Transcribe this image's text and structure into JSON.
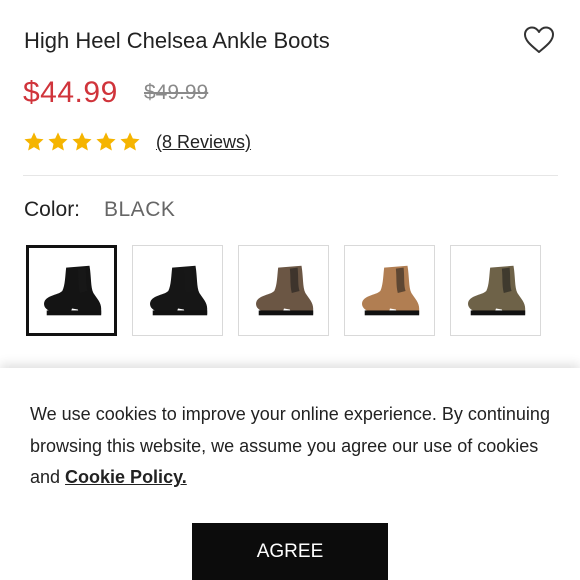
{
  "product": {
    "title": "High Heel Chelsea Ankle Boots",
    "price": "$44.99",
    "old_price": "$49.99",
    "rating_stars": 5,
    "star_color": "#f5b400",
    "reviews_label": "(8 Reviews)"
  },
  "color": {
    "label": "Color:",
    "value": "BLACK",
    "swatches": [
      {
        "name": "black-suede",
        "color": "#141414",
        "selected": true
      },
      {
        "name": "black",
        "color": "#161616",
        "selected": false
      },
      {
        "name": "brown",
        "color": "#6b5644",
        "selected": false
      },
      {
        "name": "tan",
        "color": "#b17e52",
        "selected": false
      },
      {
        "name": "olive",
        "color": "#6e6248",
        "selected": false
      }
    ]
  },
  "cookie": {
    "text_before": "We use cookies to improve your online experience. By continuing browsing this website, we assume you agree our use of cookies and ",
    "link": "Cookie Policy.",
    "button": "AGREE"
  },
  "icons": {
    "wishlist": "heart-icon",
    "rating": "star-icon"
  }
}
